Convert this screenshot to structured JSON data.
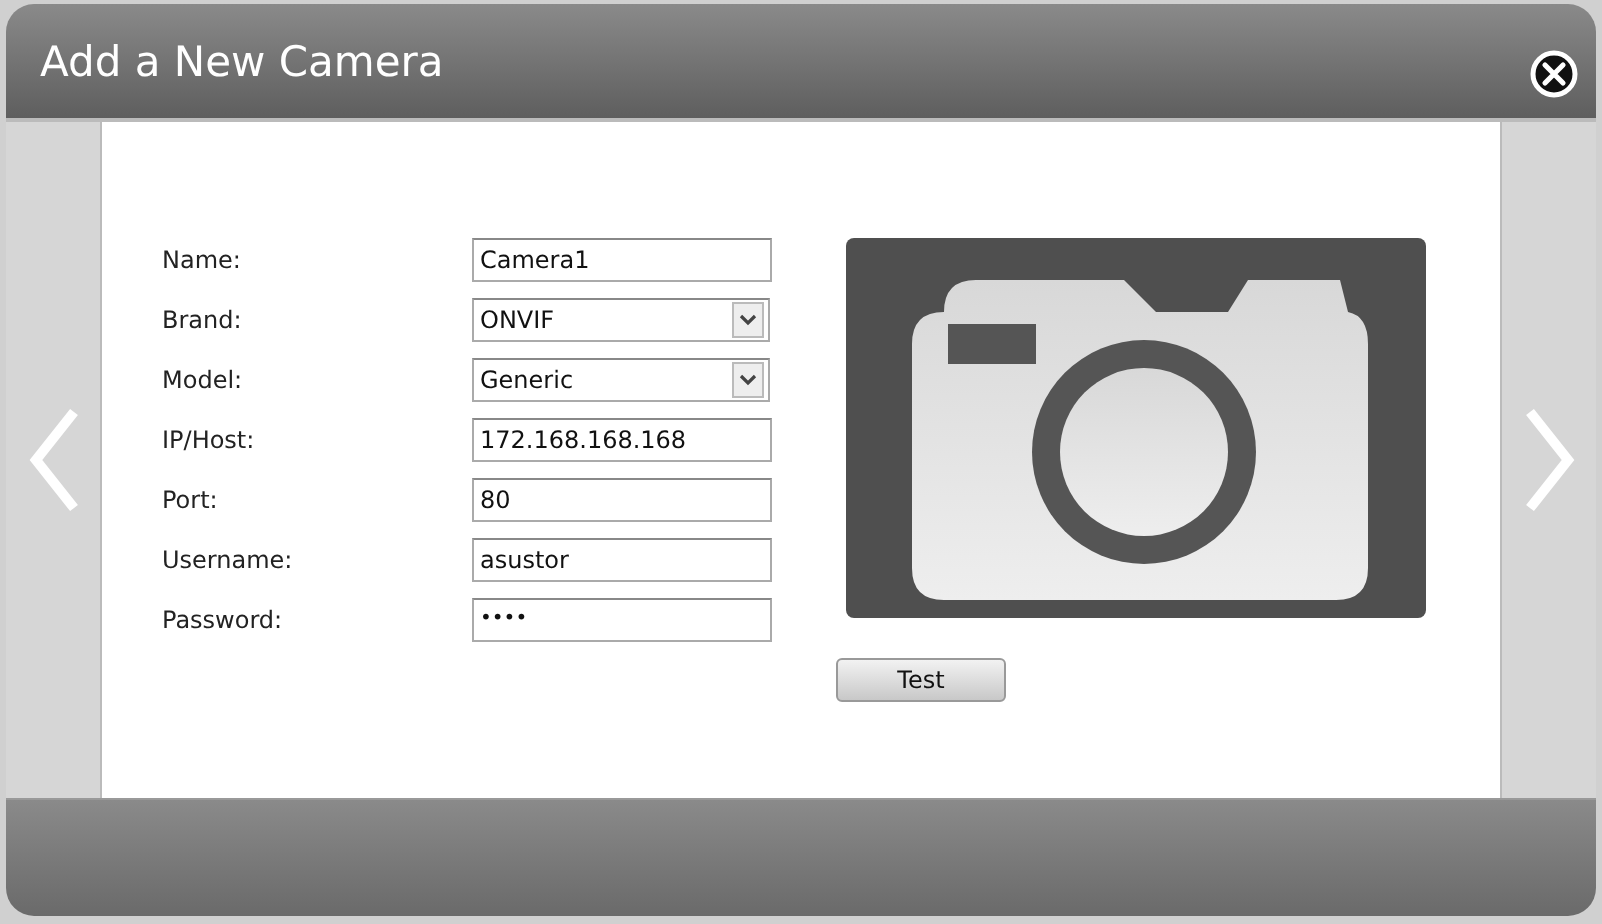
{
  "window": {
    "title": "Add a New Camera"
  },
  "fields": [
    {
      "label": "Name:",
      "kind": "text",
      "value": "Camera1"
    },
    {
      "label": "Brand:",
      "kind": "select",
      "value": "ONVIF"
    },
    {
      "label": "Model:",
      "kind": "select",
      "value": "Generic"
    },
    {
      "label": "IP/Host:",
      "kind": "text",
      "value": "172.168.168.168"
    },
    {
      "label": "Port:",
      "kind": "text",
      "value": "80"
    },
    {
      "label": "Username:",
      "kind": "text",
      "value": "asustor"
    },
    {
      "label": "Password:",
      "kind": "password",
      "value": "••••"
    }
  ],
  "buttons": [
    "Test"
  ]
}
